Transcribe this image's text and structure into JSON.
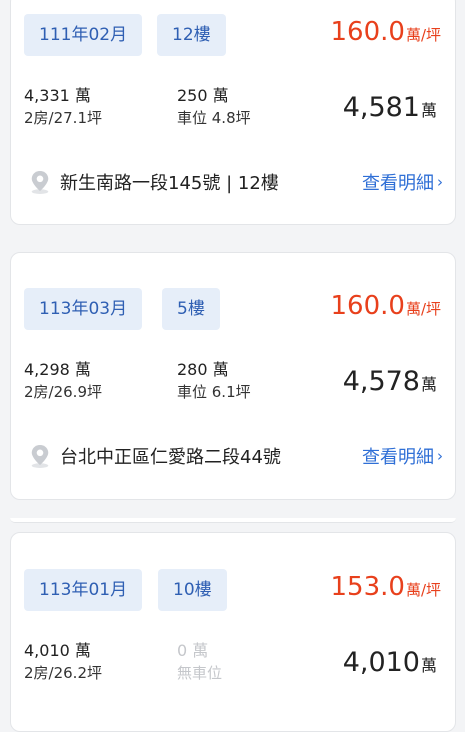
{
  "listings": [
    {
      "date": "111年02月",
      "floor": "12樓",
      "unit_price": "160.0",
      "unit_price_suffix": "萬/坪",
      "house_price": "4,331 萬",
      "layout_area": "2房/27.1坪",
      "parking_price": "250 萬",
      "parking_area": "車位 4.8坪",
      "total": "4,581",
      "total_suffix": "萬",
      "address": "新生南路一段145號 | 12樓",
      "detail_label": "查看明細",
      "detail_chevron": "›"
    },
    {
      "date": "113年03月",
      "floor": "5樓",
      "unit_price": "160.0",
      "unit_price_suffix": "萬/坪",
      "house_price": "4,298 萬",
      "layout_area": "2房/26.9坪",
      "parking_price": "280 萬",
      "parking_area": "車位 6.1坪",
      "total": "4,578",
      "total_suffix": "萬",
      "address": "台北中正區仁愛路二段44號",
      "detail_label": "查看明細",
      "detail_chevron": "›"
    },
    {
      "date": "113年01月",
      "floor": "10樓",
      "unit_price": "153.0",
      "unit_price_suffix": "萬/坪",
      "house_price": "4,010 萬",
      "layout_area": "2房/26.2坪",
      "parking_price": "0 萬",
      "parking_area": "無車位",
      "total": "4,010",
      "total_suffix": "萬"
    }
  ],
  "icons": {
    "location": "location-pin-icon",
    "chevron": "chevron-right-icon"
  },
  "colors": {
    "accent": "#2f6fd6",
    "price": "#e8401c",
    "tag_bg": "#e6eef9",
    "tag_text": "#2f5fb3",
    "muted": "#c5c7cb"
  }
}
